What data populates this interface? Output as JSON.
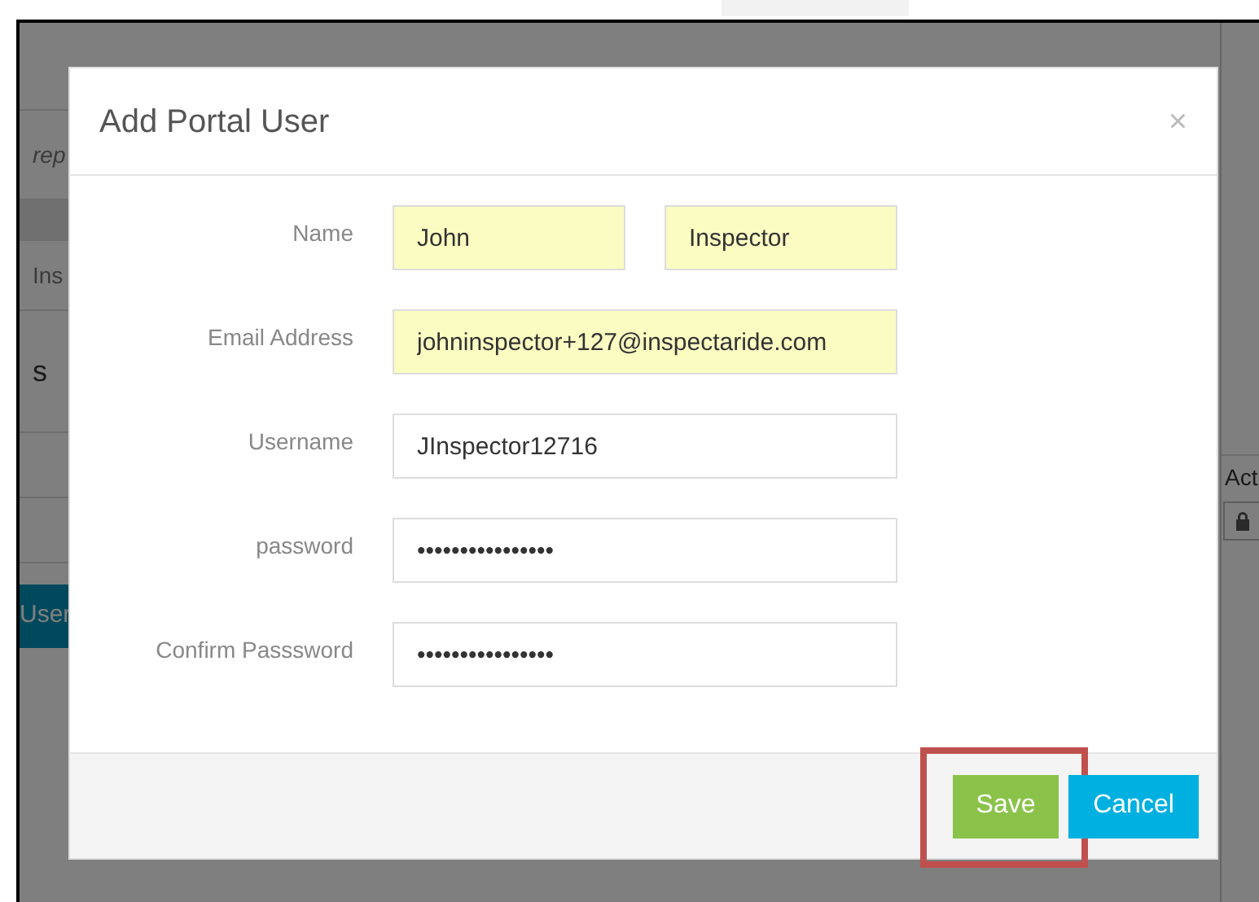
{
  "background_page": {
    "left_rows": [
      {
        "text": "rep",
        "kind": "note"
      },
      {
        "text": "Ins",
        "kind": "cell"
      },
      {
        "text": "s",
        "kind": "heading"
      }
    ],
    "left_button": "User",
    "right_header": "Act"
  },
  "modal": {
    "title": "Add Portal User",
    "close": "×",
    "fields": [
      {
        "label": "Name",
        "inputs": [
          {
            "value": "John",
            "autofilled": true
          },
          {
            "value": "Inspector",
            "autofilled": true
          }
        ]
      },
      {
        "label": "Email Address",
        "inputs": [
          {
            "value": "johninspector+127@inspectaride.com",
            "autofilled": true
          }
        ]
      },
      {
        "label": "Username",
        "inputs": [
          {
            "value": "JInspector12716",
            "autofilled": false
          }
        ]
      },
      {
        "label": "password",
        "inputs": [
          {
            "value": "••••••••••••••••",
            "autofilled": false
          }
        ]
      },
      {
        "label": "Confirm Passsword",
        "inputs": [
          {
            "value": "••••••••••••••••",
            "autofilled": false
          }
        ]
      }
    ],
    "buttons": [
      {
        "label": "Save",
        "kind": "primary",
        "highlighted": true
      },
      {
        "label": "Cancel",
        "kind": "secondary",
        "highlighted": false
      }
    ]
  }
}
